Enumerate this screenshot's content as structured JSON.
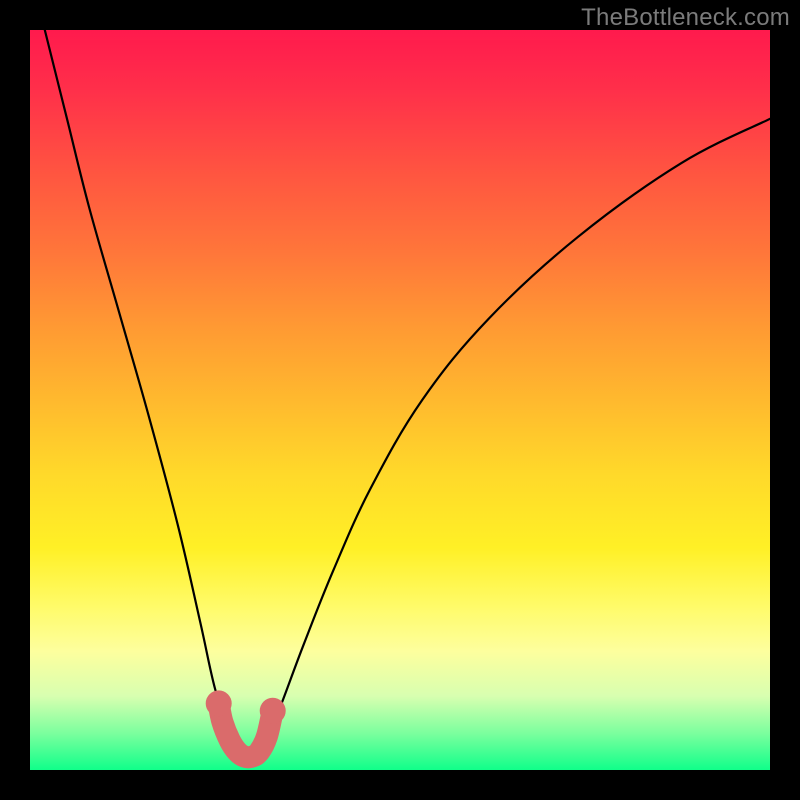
{
  "watermark": "TheBottleneck.com",
  "chart_data": {
    "type": "line",
    "title": "",
    "xlabel": "",
    "ylabel": "",
    "xlim": [
      0,
      100
    ],
    "ylim": [
      0,
      100
    ],
    "series": [
      {
        "name": "bottleneck-curve",
        "x": [
          2,
          5,
          8,
          12,
          16,
          20,
          23,
          25,
          27,
          28,
          29,
          30,
          31,
          32,
          34,
          37,
          41,
          46,
          53,
          62,
          74,
          88,
          100
        ],
        "values": [
          100,
          88,
          76,
          62,
          48,
          33,
          20,
          11,
          5,
          2,
          1,
          1,
          2,
          4,
          9,
          17,
          27,
          38,
          50,
          61,
          72,
          82,
          88
        ]
      }
    ],
    "markers": {
      "name": "highlight-segment",
      "color": "#da6b6b",
      "x": [
        25.5,
        26.0,
        27.0,
        28.0,
        29.0,
        30.0,
        31.0,
        32.0,
        32.8
      ],
      "values": [
        9.0,
        6.5,
        4.0,
        2.5,
        1.8,
        1.8,
        2.5,
        4.5,
        8.0
      ]
    },
    "gradient_stops": [
      {
        "pos": 0.0,
        "color": "#ff1a4d"
      },
      {
        "pos": 0.4,
        "color": "#ff9933"
      },
      {
        "pos": 0.7,
        "color": "#fff026"
      },
      {
        "pos": 1.0,
        "color": "#10ff8a"
      }
    ]
  }
}
